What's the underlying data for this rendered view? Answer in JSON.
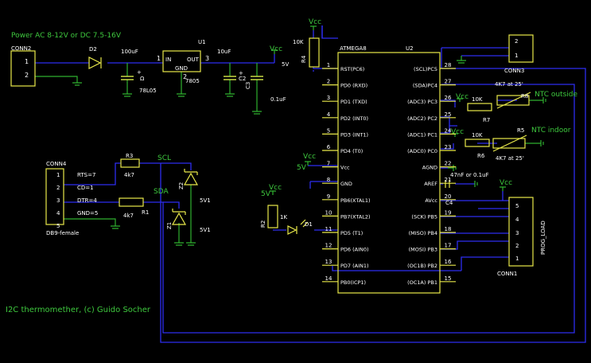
{
  "title": "I2C thermomether, (c) Guido Socher",
  "power_label": "Power AC 8-12V or DC 7.5-16V",
  "labels": {
    "conn2": "CONN2",
    "conn3": "CONN3",
    "conn4": "CONN4",
    "conn1": "CONN1",
    "db9": "DB9-female",
    "d2": "D2",
    "d1": "D1",
    "u1": "U1",
    "u2": "U2",
    "ic_name": "ATMEGA8",
    "reg_name": "78L05",
    "reg_part": "7805",
    "reg_in": "IN",
    "reg_gnd": "GND",
    "reg_out": "OUT",
    "cap100": "100uF",
    "cap10": "10uF",
    "cap01": "0.1uF",
    "c3": "C3",
    "c2": "C2",
    "vcc": "Vcc",
    "fivev": "5V",
    "r4": "R4",
    "tenk": "10K",
    "r3": "R3",
    "r1": "R1",
    "r2": "R2",
    "fourk7": "4k7",
    "onek": "1K",
    "scl": "SCL",
    "sda": "SDA",
    "z1": "Z1",
    "z2": "Z2",
    "fivev1": "5V1",
    "rts": "RTS=7",
    "cd": "CD=1",
    "dtr": "DTR=4",
    "gnd5": "GND=5",
    "r7": "R7",
    "r8": "R8",
    "r5": "R5",
    "r6": "R6",
    "ntc_out": "NTC outside",
    "ntc_in": "NTC indoor",
    "at25_1": "4K7 at 25'",
    "at25_2": "4K7 at 25'",
    "c4": "C4",
    "cap_aref": "47nF or 0.1uF",
    "prog": "PROG_LOAD"
  },
  "conn_pins": {
    "conn2": [
      "1",
      "2"
    ],
    "conn3": [
      "2",
      "1"
    ],
    "conn4": [
      "1",
      "2",
      "3",
      "4",
      "5"
    ],
    "conn1": [
      "5",
      "4",
      "3",
      "2",
      "1"
    ]
  },
  "ic_left": [
    {
      "num": "1",
      "name": "RST(PC6)"
    },
    {
      "num": "2",
      "name": "PD0 (RXD)"
    },
    {
      "num": "3",
      "name": "PD1 (TXD)"
    },
    {
      "num": "4",
      "name": "PD2 (INT0)"
    },
    {
      "num": "5",
      "name": "PD3 (INT1)"
    },
    {
      "num": "6",
      "name": "PD4 (T0)"
    },
    {
      "num": "7",
      "name": "Vcc"
    },
    {
      "num": "8",
      "name": "GND"
    },
    {
      "num": "9",
      "name": "PB6(XTAL1)"
    },
    {
      "num": "10",
      "name": "PB7(XTAL2)"
    },
    {
      "num": "11",
      "name": "PD5 (T1)"
    },
    {
      "num": "12",
      "name": "PD6 (AIN0)"
    },
    {
      "num": "13",
      "name": "PD7 (AIN1)"
    },
    {
      "num": "14",
      "name": "PB0(ICP1)"
    }
  ],
  "ic_right": [
    {
      "num": "28",
      "name": "(SCL)PC5"
    },
    {
      "num": "27",
      "name": "(SDA)PC4"
    },
    {
      "num": "26",
      "name": "(ADC3) PC3"
    },
    {
      "num": "25",
      "name": "(ADC2) PC2"
    },
    {
      "num": "24",
      "name": "(ADC1) PC1"
    },
    {
      "num": "23",
      "name": "(ADC0) PC0"
    },
    {
      "num": "22",
      "name": "AGND"
    },
    {
      "num": "21",
      "name": "AREF"
    },
    {
      "num": "20",
      "name": "AVcc"
    },
    {
      "num": "19",
      "name": "(SCK) PB5"
    },
    {
      "num": "18",
      "name": "(MISO) PB4"
    },
    {
      "num": "17",
      "name": "(MOSI) PB3"
    },
    {
      "num": "16",
      "name": "(OC1B) PB2"
    },
    {
      "num": "15",
      "name": "(OC1A) PB1"
    }
  ]
}
